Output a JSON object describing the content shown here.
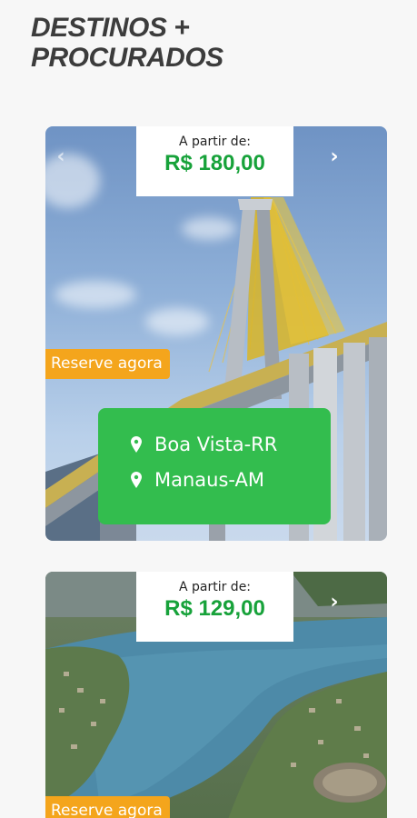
{
  "section": {
    "title_line1": "DESTINOS +",
    "title_line2": "PROCURADOS"
  },
  "colors": {
    "accent_green": "#17a23a",
    "route_green": "#33bd4e",
    "badge_orange": "#f4a51c"
  },
  "cards": [
    {
      "price_label": "A partir de:",
      "price_value": "R$ 180,00",
      "reserve_label": "Reserve agora",
      "prev_icon": "chevron-left-icon",
      "next_icon": "chevron-right-icon",
      "origin": "Boa Vista-RR",
      "destination": "Manaus-AM"
    },
    {
      "price_label": "A partir de:",
      "price_value": "R$ 129,00",
      "reserve_label": "Reserve agora",
      "next_icon": "chevron-right-icon"
    }
  ]
}
